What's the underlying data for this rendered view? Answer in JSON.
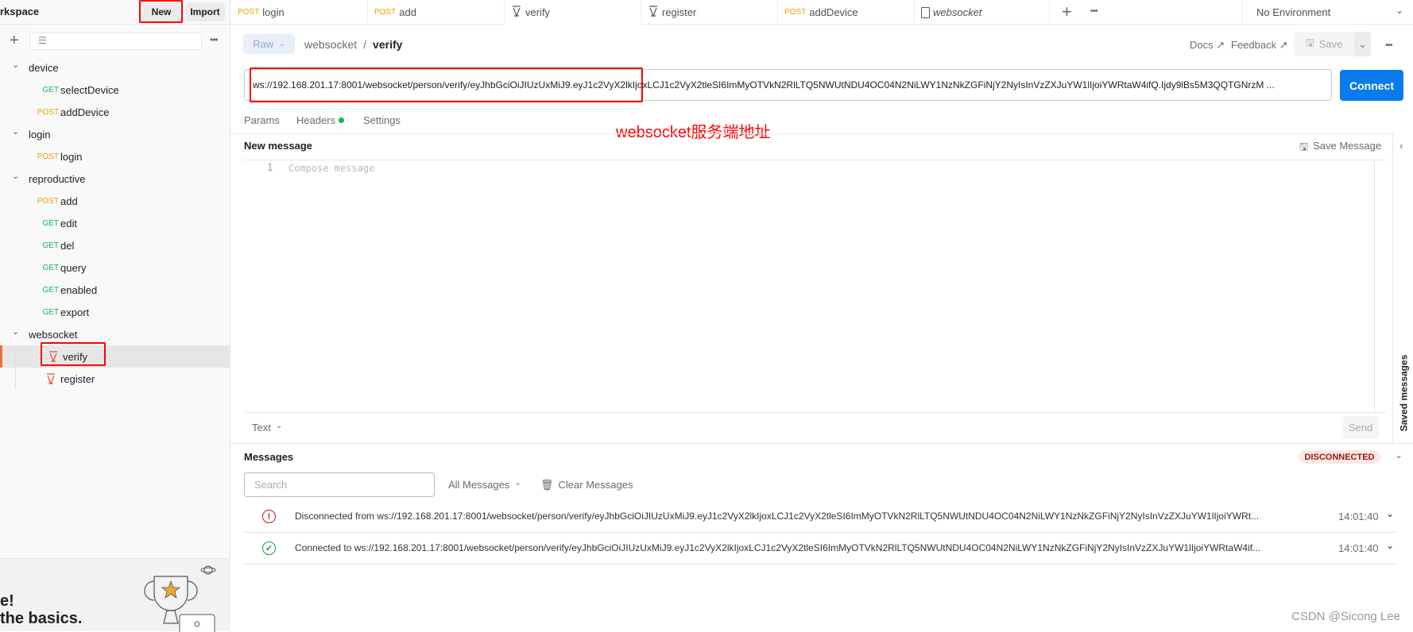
{
  "sidebar": {
    "workspace_label": "rkspace",
    "new_label": "New",
    "import_label": "Import",
    "tree": [
      {
        "type": "folder",
        "label": "device"
      },
      {
        "type": "request",
        "method": "GET",
        "label": "selectDevice"
      },
      {
        "type": "request",
        "method": "POST",
        "label": "addDevice"
      },
      {
        "type": "folder",
        "label": "login"
      },
      {
        "type": "request",
        "method": "POST",
        "label": "login"
      },
      {
        "type": "folder",
        "label": "reproductive"
      },
      {
        "type": "request",
        "method": "POST",
        "label": "add"
      },
      {
        "type": "request",
        "method": "GET",
        "label": "edit"
      },
      {
        "type": "request",
        "method": "GET",
        "label": "del"
      },
      {
        "type": "request",
        "method": "GET",
        "label": "query"
      },
      {
        "type": "request",
        "method": "GET",
        "label": "enabled"
      },
      {
        "type": "request",
        "method": "GET",
        "label": "export"
      },
      {
        "type": "folder",
        "label": "websocket"
      },
      {
        "type": "ws",
        "label": "verify",
        "selected": true
      },
      {
        "type": "ws",
        "label": "register"
      }
    ],
    "banner_line1": "e!",
    "banner_line2": "the basics."
  },
  "tabs": [
    {
      "method": "POST",
      "label": "login"
    },
    {
      "method": "POST",
      "label": "add"
    },
    {
      "icon": "websocket-icon",
      "label": "verify",
      "active": true
    },
    {
      "icon": "websocket-icon",
      "label": "register"
    },
    {
      "method": "POST",
      "label": "addDevice"
    },
    {
      "icon": "collection-icon",
      "label": "websocket"
    }
  ],
  "environment": "No Environment",
  "request": {
    "mode": "Raw",
    "breadcrumb_parent": "websocket",
    "breadcrumb_sep": "/",
    "breadcrumb_current": "verify",
    "docs": "Docs ↗",
    "feedback": "Feedback ↗",
    "save": "Save",
    "url": "ws://192.168.201.17:8001/websocket/person/verify/eyJhbGciOiJIUzUxMiJ9.eyJ1c2VyX2lkIjoxLCJ1c2VyX2tleSI6ImMyOTVkN2RlLTQ5NWUtNDU4OC04N2NiLWY1NzNkZGFiNjY2NyIsInVzZXJuYW1lIjoiYWRtaW4ifQ.Ijdy9lBs5M3QQTGNrzM ...",
    "connect": "Connect",
    "subtabs": [
      "Params",
      "Headers",
      "Settings"
    ],
    "annotation": "websocket服务端地址"
  },
  "compose": {
    "title": "New message",
    "save_message": "Save Message",
    "line_number": "1",
    "placeholder": "Compose message",
    "format": "Text",
    "send": "Send",
    "saved_messages": "Saved messages"
  },
  "messages": {
    "title": "Messages",
    "status": "DISCONNECTED",
    "search_placeholder": "Search",
    "filter": "All Messages",
    "clear": "Clear Messages",
    "items": [
      {
        "type": "disconnected",
        "text": "Disconnected from ws://192.168.201.17:8001/websocket/person/verify/eyJhbGciOiJIUzUxMiJ9.eyJ1c2VyX2lkIjoxLCJ1c2VyX2tleSI6ImMyOTVkN2RlLTQ5NWUtNDU4OC04N2NiLWY1NzNkZGFiNjY2NyIsInVzZXJuYW1lIjoiYWRt...",
        "time": "14:01:40"
      },
      {
        "type": "connected",
        "text": "Connected to ws://192.168.201.17:8001/websocket/person/verify/eyJhbGciOiJIUzUxMiJ9.eyJ1c2VyX2lkIjoxLCJ1c2VyX2tleSI6ImMyOTVkN2RlLTQ5NWUtNDU4OC04N2NiLWY1NzNkZGFiNjY2NyIsInVzZXJuYW1lIjoiYWRtaW4if...",
        "time": "14:01:40"
      }
    ]
  },
  "watermark": "CSDN @Sicong Lee",
  "colors": {
    "accent": "#097bed",
    "get": "#0cbb52",
    "post": "#e6a100",
    "websocket": "#e5532d",
    "error": "#b4201c",
    "success": "#0e9a4d",
    "annotation": "#ff0000"
  }
}
